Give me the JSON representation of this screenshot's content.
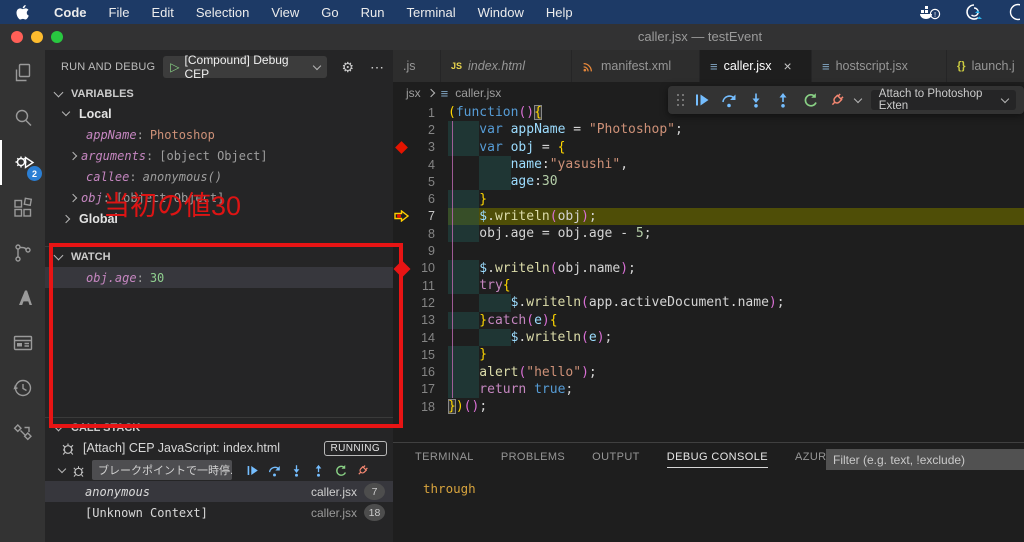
{
  "menubar": {
    "items": [
      "Code",
      "File",
      "Edit",
      "Selection",
      "View",
      "Go",
      "Run",
      "Terminal",
      "Window",
      "Help"
    ]
  },
  "titlebar": {
    "title": "caller.jsx — testEvent"
  },
  "activity_bar": {
    "debug_badge": "2"
  },
  "sidebar": {
    "header": {
      "title": "RUN AND DEBUG",
      "dropdown_label": "[Compound] Debug CEP"
    },
    "variables": {
      "title": "VARIABLES",
      "scopes": [
        {
          "label": "Local",
          "chevron": "down",
          "items": [
            {
              "name": "appName",
              "value": "Photoshop",
              "value_color": "orange",
              "chevron": false
            },
            {
              "name": "arguments",
              "value": "[object Object]",
              "value_color": "gray",
              "chevron": true
            },
            {
              "name": "callee",
              "value": "anonymous()",
              "value_color": "gray-italic",
              "chevron": false
            },
            {
              "name": "obj",
              "value": "[object Object]",
              "value_color": "gray",
              "chevron": true
            }
          ]
        },
        {
          "label": "Global",
          "chevron": "right",
          "items": []
        }
      ]
    },
    "watch": {
      "title": "WATCH",
      "items": [
        {
          "name": "obj.age",
          "value": "30",
          "value_color": "green",
          "selected": true
        }
      ]
    },
    "call_stack": {
      "title": "CALL STACK",
      "session": "[Attach] CEP JavaScript: index.html",
      "status_badge": "RUNNING",
      "pause_reason": "ブレークポイントで一時停...",
      "frames": [
        {
          "name": "anonymous",
          "file": "caller.jsx",
          "line": "7",
          "selected": true,
          "italic": true
        },
        {
          "name": "[Unknown Context]",
          "file": "caller.jsx",
          "line": "18",
          "selected": false,
          "italic": false
        }
      ]
    }
  },
  "annotation": {
    "text": "当初の値30",
    "color": "#dd1414"
  },
  "editor": {
    "tabs": [
      {
        "label": ".js",
        "icon": "none",
        "active": false,
        "italic": false,
        "close": false,
        "width": 48
      },
      {
        "label": "index.html",
        "icon": "js",
        "active": false,
        "italic": true,
        "close": false,
        "width": 131
      },
      {
        "label": "manifest.xml",
        "icon": "feed",
        "active": false,
        "italic": false,
        "close": false,
        "width": 128
      },
      {
        "label": "caller.jsx",
        "icon": "lines",
        "active": true,
        "italic": false,
        "close": true,
        "width": 112
      },
      {
        "label": "hostscript.jsx",
        "icon": "lines",
        "active": false,
        "italic": false,
        "close": false,
        "width": 135
      },
      {
        "label": "launch.j",
        "icon": "braces",
        "active": false,
        "italic": false,
        "close": false,
        "width": 90
      }
    ],
    "breadcrumb_root": "jsx",
    "breadcrumb_file": "caller.jsx",
    "debug_toolbar": {
      "dropdown": "Attach to Photoshop Exten"
    },
    "code": {
      "breakpoint_line": 3,
      "current_line": 7,
      "lines": [
        {
          "n": 1,
          "indent": 0,
          "tokens": [
            [
              "(",
              "g"
            ],
            [
              "function",
              "k"
            ],
            [
              "()",
              "m"
            ],
            [
              "{",
              "bm"
            ]
          ]
        },
        {
          "n": 2,
          "indent": 1,
          "tokens": [
            [
              "var ",
              "k"
            ],
            [
              "appName",
              "v"
            ],
            [
              " = ",
              "p"
            ],
            [
              "\"Photoshop\"",
              "s"
            ],
            [
              ";",
              "p"
            ]
          ]
        },
        {
          "n": 3,
          "indent": 1,
          "tokens": [
            [
              "var ",
              "k"
            ],
            [
              "obj",
              "v"
            ],
            [
              " = ",
              "p"
            ],
            [
              "{",
              "g"
            ]
          ]
        },
        {
          "n": 4,
          "indent": 2,
          "tokens": [
            [
              "name",
              "v"
            ],
            [
              ":",
              "p"
            ],
            [
              "\"yasushi\"",
              "s"
            ],
            [
              ",",
              "p"
            ]
          ]
        },
        {
          "n": 5,
          "indent": 2,
          "tokens": [
            [
              "age",
              "v"
            ],
            [
              ":",
              "p"
            ],
            [
              "30",
              "n"
            ]
          ]
        },
        {
          "n": 6,
          "indent": 1,
          "tokens": [
            [
              "}",
              "g"
            ]
          ]
        },
        {
          "n": 7,
          "indent": 1,
          "tokens": [
            [
              "$",
              "v"
            ],
            [
              ".",
              "p"
            ],
            [
              "writeln",
              "f"
            ],
            [
              "(",
              "m"
            ],
            [
              "obj",
              "p"
            ],
            [
              ")",
              "m"
            ],
            [
              ";",
              "p"
            ]
          ]
        },
        {
          "n": 8,
          "indent": 1,
          "tokens": [
            [
              "obj",
              "p"
            ],
            [
              ".",
              "p"
            ],
            [
              "age",
              "p"
            ],
            [
              " = ",
              "p"
            ],
            [
              "obj",
              "p"
            ],
            [
              ".",
              "p"
            ],
            [
              "age",
              "p"
            ],
            [
              " - ",
              "p"
            ],
            [
              "5",
              "n"
            ],
            [
              ";",
              "p"
            ]
          ]
        },
        {
          "n": 9,
          "indent": 0,
          "tokens": []
        },
        {
          "n": 10,
          "indent": 1,
          "tokens": [
            [
              "$",
              "v"
            ],
            [
              ".",
              "p"
            ],
            [
              "writeln",
              "f"
            ],
            [
              "(",
              "m"
            ],
            [
              "obj",
              "p"
            ],
            [
              ".",
              "p"
            ],
            [
              "name",
              "p"
            ],
            [
              ")",
              "m"
            ],
            [
              ";",
              "p"
            ]
          ]
        },
        {
          "n": 11,
          "indent": 1,
          "tokens": [
            [
              "try",
              "c"
            ],
            [
              "{",
              "g"
            ]
          ]
        },
        {
          "n": 12,
          "indent": 2,
          "tokens": [
            [
              "$",
              "v"
            ],
            [
              ".",
              "p"
            ],
            [
              "writeln",
              "f"
            ],
            [
              "(",
              "m"
            ],
            [
              "app",
              "p"
            ],
            [
              ".",
              "p"
            ],
            [
              "activeDocument",
              "p"
            ],
            [
              ".",
              "p"
            ],
            [
              "name",
              "p"
            ],
            [
              ")",
              "m"
            ],
            [
              ";",
              "p"
            ]
          ]
        },
        {
          "n": 13,
          "indent": 1,
          "tokens": [
            [
              "}",
              "g"
            ],
            [
              "catch",
              "c"
            ],
            [
              "(",
              "m"
            ],
            [
              "e",
              "v"
            ],
            [
              ")",
              "m"
            ],
            [
              "{",
              "g"
            ]
          ]
        },
        {
          "n": 14,
          "indent": 2,
          "tokens": [
            [
              "$",
              "v"
            ],
            [
              ".",
              "p"
            ],
            [
              "writeln",
              "f"
            ],
            [
              "(",
              "m"
            ],
            [
              "e",
              "v"
            ],
            [
              ")",
              "m"
            ],
            [
              ";",
              "p"
            ]
          ]
        },
        {
          "n": 15,
          "indent": 1,
          "tokens": [
            [
              "}",
              "g"
            ]
          ]
        },
        {
          "n": 16,
          "indent": 1,
          "tokens": [
            [
              "alert",
              "f"
            ],
            [
              "(",
              "m"
            ],
            [
              "\"hello\"",
              "s"
            ],
            [
              ")",
              "m"
            ],
            [
              ";",
              "p"
            ]
          ]
        },
        {
          "n": 17,
          "indent": 1,
          "tokens": [
            [
              "return ",
              "c"
            ],
            [
              "true",
              "k"
            ],
            [
              ";",
              "p"
            ]
          ]
        },
        {
          "n": 18,
          "indent": 0,
          "tokens": [
            [
              "}",
              "bm"
            ],
            [
              ")",
              "g"
            ],
            [
              "()",
              "m"
            ],
            [
              ";",
              "p"
            ]
          ]
        }
      ]
    }
  },
  "panel": {
    "tabs": [
      "TERMINAL",
      "PROBLEMS",
      "OUTPUT",
      "DEBUG CONSOLE",
      "AZURE"
    ],
    "active_tab": "DEBUG CONSOLE",
    "filter_placeholder": "Filter (e.g. text, !exclude)",
    "output": "through"
  },
  "colors": {
    "menubar": "#1d3a66",
    "annotation_red": "#e81414",
    "current_line": "#4f4e07",
    "breakpoint": "#e51400",
    "badge_blue": "#2b7fd4",
    "debug_icon_blue": "#75beff",
    "restart_green": "#89d185",
    "disconnect_red": "#f48771"
  }
}
